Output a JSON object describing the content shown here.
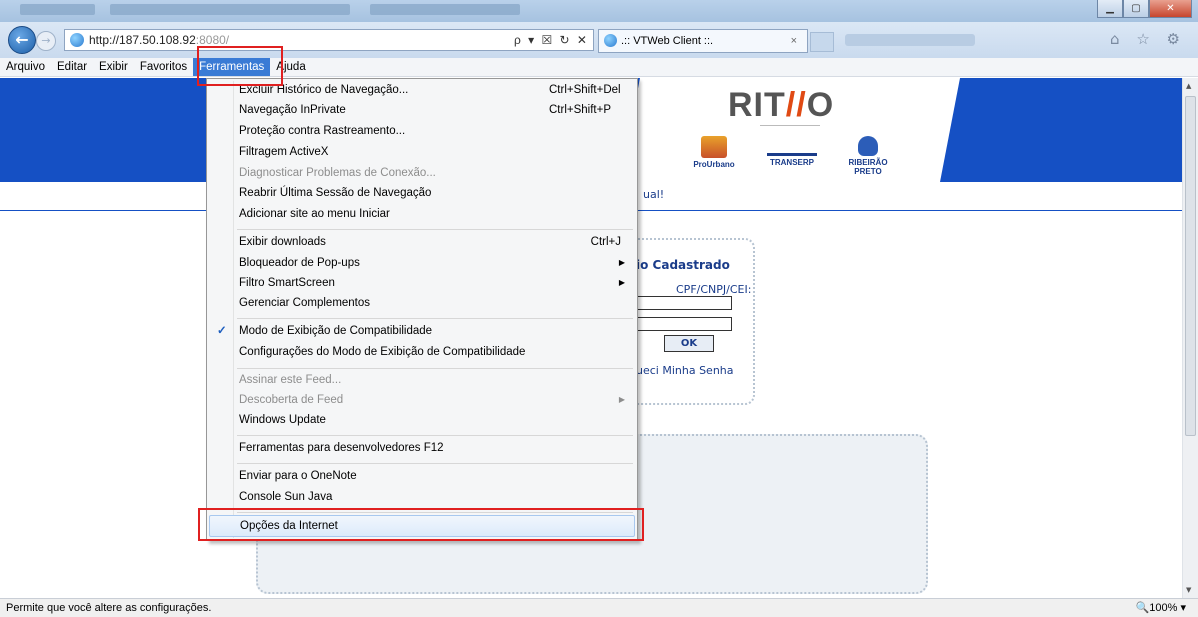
{
  "window": {
    "controls": [
      "minimize",
      "maximize",
      "close"
    ]
  },
  "address_bar": {
    "url_host": "http://187.50.108.92",
    "url_port": ":8080/",
    "controls": "ρ ▾ ☒ ↻ ✕"
  },
  "tab": {
    "title": ".:: VTWeb Client ::.",
    "close": "×"
  },
  "toolbar_icons": "⌂ ☆ ⚙",
  "menubar": {
    "items": [
      "Arquivo",
      "Editar",
      "Exibir",
      "Favoritos",
      "Ferramentas",
      "Ajuda"
    ],
    "active": "Ferramentas"
  },
  "page": {
    "logo": {
      "left": "RIT",
      "mid": "//",
      "right": "O"
    },
    "partners": [
      "ProUrbano",
      "TRANSERP",
      "RIBEIRÃO PRETO"
    ],
    "divider_text": "ual!",
    "login": {
      "title": "io Cadastrado",
      "label": "CPF/CNPJ/CEI:",
      "ok": "OK",
      "forgot": "ueci Minha Senha"
    }
  },
  "dropdown": {
    "items": [
      {
        "label": "Excluir Histórico de Navegação...",
        "shortcut": "Ctrl+Shift+Del"
      },
      {
        "label": "Navegação InPrivate",
        "shortcut": "Ctrl+Shift+P"
      },
      {
        "label": "Proteção contra Rastreamento..."
      },
      {
        "label": "Filtragem ActiveX"
      },
      {
        "label": "Diagnosticar Problemas de Conexão...",
        "disabled": true
      },
      {
        "label": "Reabrir Última Sessão de Navegação"
      },
      {
        "label": "Adicionar site ao menu Iniciar"
      },
      {
        "label": "Exibir downloads",
        "shortcut": "Ctrl+J"
      },
      {
        "label": "Bloqueador de Pop-ups",
        "submenu": true
      },
      {
        "label": "Filtro SmartScreen",
        "submenu": true
      },
      {
        "label": "Gerenciar Complementos"
      },
      {
        "label": "Modo de Exibição de Compatibilidade",
        "checked": true
      },
      {
        "label": "Configurações do Modo de Exibição de Compatibilidade"
      },
      {
        "label": "Assinar este Feed...",
        "disabled": true
      },
      {
        "label": "Descoberta de Feed",
        "disabled": true,
        "submenu": true
      },
      {
        "label": "Windows Update"
      },
      {
        "label": "Ferramentas para desenvolvedores F12"
      },
      {
        "label": "Enviar para o OneNote"
      },
      {
        "label": "Console Sun Java"
      },
      {
        "label": "Opções da Internet",
        "highlighted": true
      }
    ]
  },
  "statusbar": {
    "text": "Permite que você altere as configurações.",
    "zoom": "🔍100%  ▾"
  },
  "colors": {
    "banner_blue": "#1550c4",
    "menu_active": "#3a7bd5",
    "highlight_red": "#e02020"
  }
}
